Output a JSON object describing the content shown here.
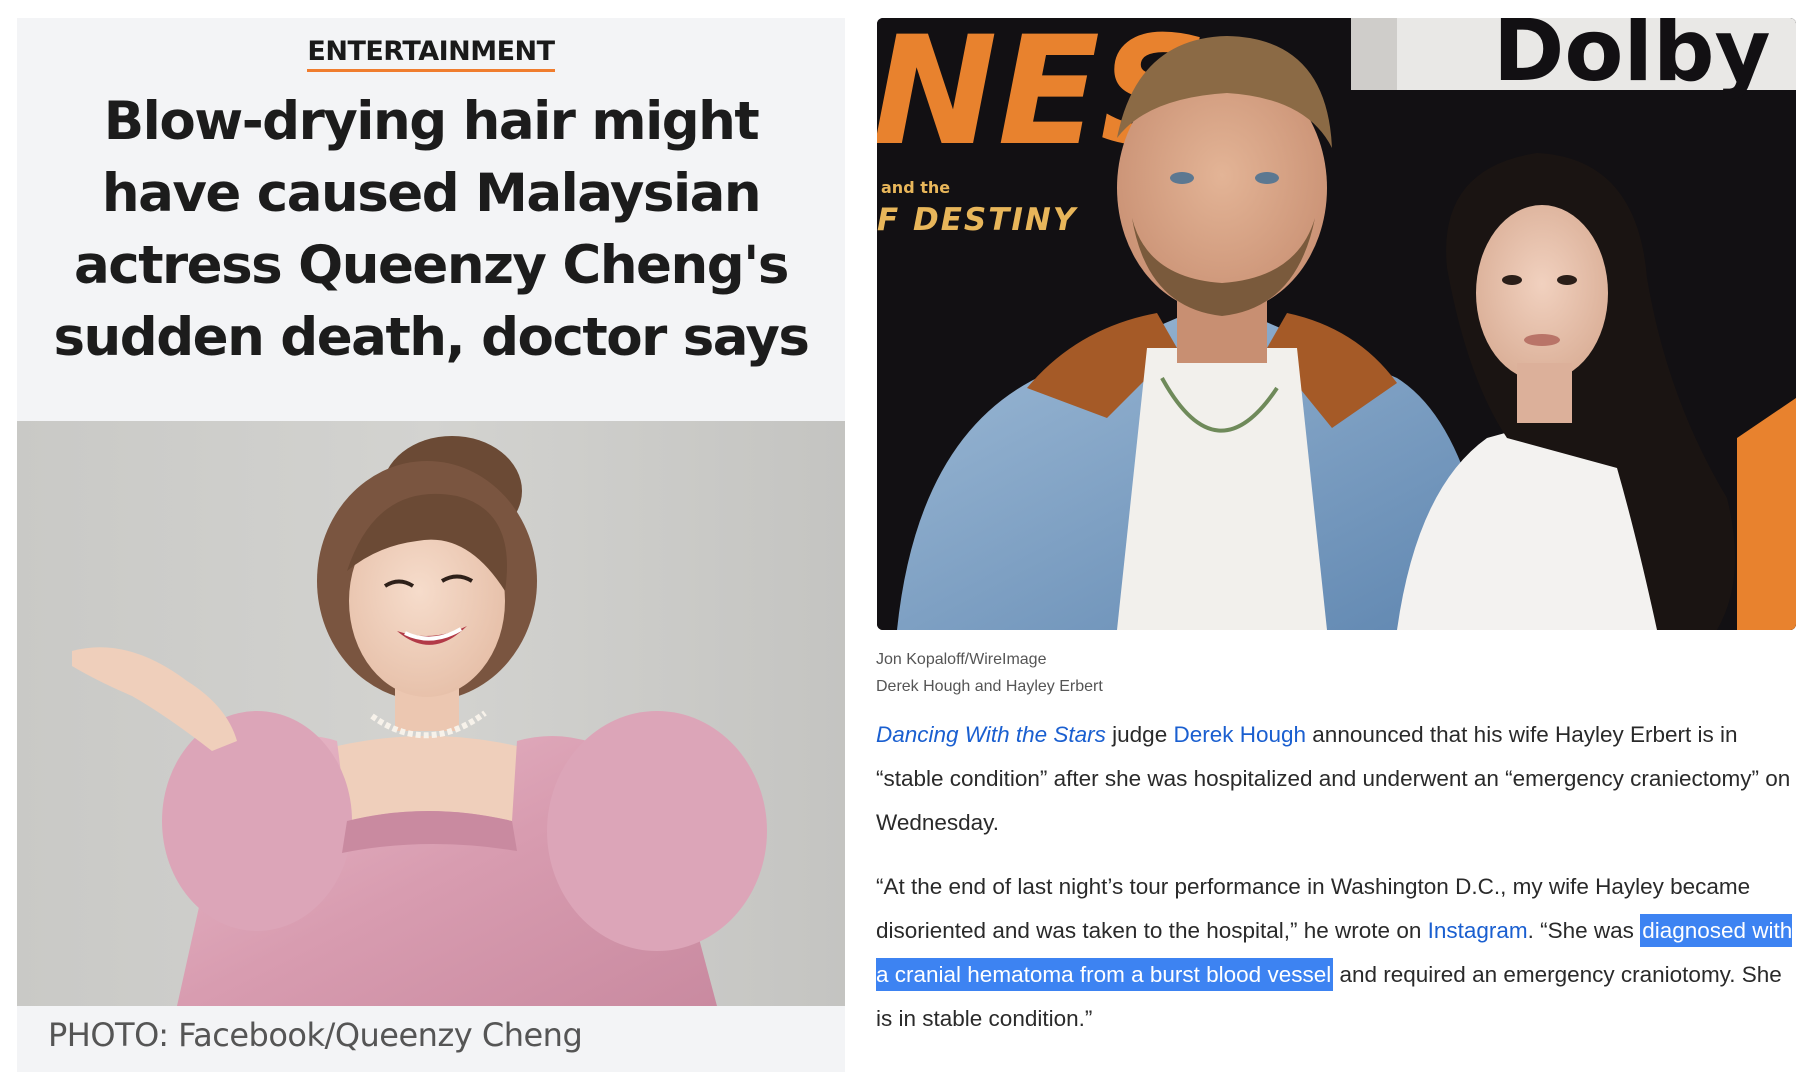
{
  "left": {
    "category": "ENTERTAINMENT",
    "headline": "Blow-drying hair might have caused Malaysian actress Queenzy Cheng's sudden death, doctor says",
    "photo_caption": "PHOTO: Facebook/Queenzy Cheng",
    "accent_color": "#f07d2e"
  },
  "right": {
    "photo_backdrop": {
      "poster_word": "NES",
      "poster_small": "and the",
      "poster_destiny": "F DESTINY",
      "brand": "Dolby"
    },
    "credit_line": "Jon Kopaloff/WireImage",
    "caption_line": "Derek Hough and Hayley Erbert",
    "p1": {
      "link1": "Dancing With the Stars",
      "t1": " judge ",
      "link2": "Derek Hough",
      "t2": " announced that his wife Hayley Erbert is in “stable condition” after she was hospitalized and underwent an “emergency craniectomy” on Wednesday."
    },
    "p2": {
      "t1": "“At the end of last night’s tour performance in Washington D.C., my wife Hayley became disoriented and was taken to the hospital,” he wrote on ",
      "link": "Instagram",
      "t2": ". “She was ",
      "highlight": "diagnosed with a cranial hematoma from a burst blood vessel",
      "t3": " and required an emergency craniotomy. She is in stable condition.”"
    },
    "link_color": "#1a5fd0",
    "highlight_color": "#3d83f2"
  }
}
